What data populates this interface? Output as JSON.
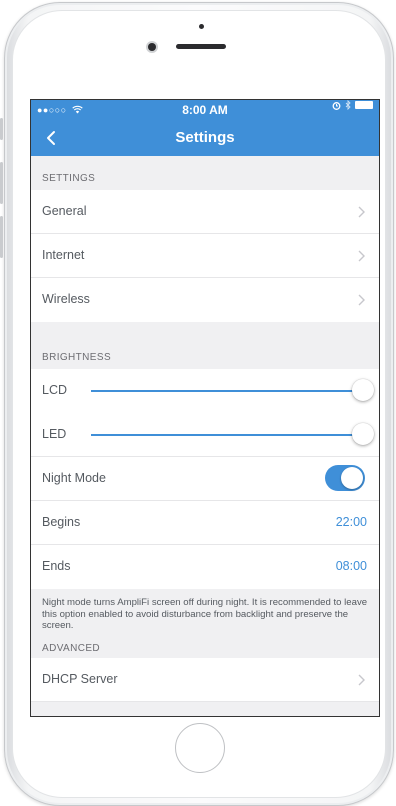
{
  "status_bar": {
    "signal": "●●○○○",
    "time": "8:00 AM"
  },
  "nav": {
    "title": "Settings"
  },
  "sections": {
    "settings": {
      "header": "SETTINGS",
      "items": [
        {
          "label": "General"
        },
        {
          "label": "Internet"
        },
        {
          "label": "Wireless"
        }
      ]
    },
    "brightness": {
      "header": "BRIGHTNESS",
      "lcd": {
        "label": "LCD",
        "level": 1.0
      },
      "led": {
        "label": "LED",
        "level": 1.0
      },
      "night_mode": {
        "label": "Night Mode",
        "enabled": true
      },
      "begins": {
        "label": "Begins",
        "value": "22:00"
      },
      "ends": {
        "label": "Ends",
        "value": "08:00"
      },
      "note": "Night mode turns AmpliFi screen off during night. It is recommended to leave this option enabled to avoid disturbance from backlight and preserve the screen."
    },
    "advanced": {
      "header": "ADVANCED",
      "items": [
        {
          "label": "DHCP Server"
        }
      ]
    }
  },
  "colors": {
    "accent": "#3f8fd8",
    "background": "#f0f0f2",
    "text": "#555a60"
  },
  "icons": {
    "back": "chevron-left-icon",
    "chevron": "chevron-right-icon",
    "wifi": "wifi-icon",
    "alarm": "alarm-icon",
    "bluetooth": "bluetooth-icon",
    "battery": "battery-icon"
  }
}
